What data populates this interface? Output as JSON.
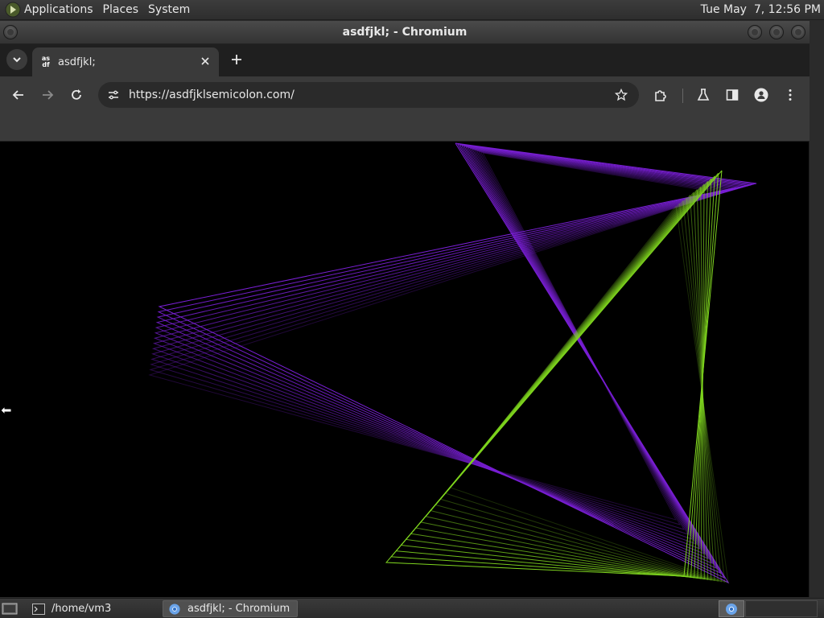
{
  "top_panel": {
    "menus": [
      "Applications",
      "Places",
      "System"
    ],
    "clock": "Tue May  7, 12:56 PM"
  },
  "window": {
    "title": "asdfjkl; - Chromium"
  },
  "tabs": [
    {
      "label": "asdfjkl;",
      "favicon_text": "as df",
      "active": true
    }
  ],
  "toolbar": {
    "url": "https://asdfjklsemicolon.com/",
    "icons": [
      "back-icon",
      "forward-icon",
      "reload-icon",
      "site-info-icon",
      "bookmark-star-icon",
      "extensions-icon",
      "labs-icon",
      "side-panel-icon",
      "profile-icon",
      "menu-icon"
    ]
  },
  "content": {
    "description_colors": {
      "background": "#000000",
      "purple": "#7a1fd6",
      "green": "#7fd61f"
    }
  },
  "bottom_panel": {
    "tasks": [
      {
        "label": "/home/vm3",
        "icon": "terminal-icon"
      },
      {
        "label": "asdfjkl; - Chromium",
        "icon": "chromium-icon",
        "active": true
      }
    ]
  }
}
